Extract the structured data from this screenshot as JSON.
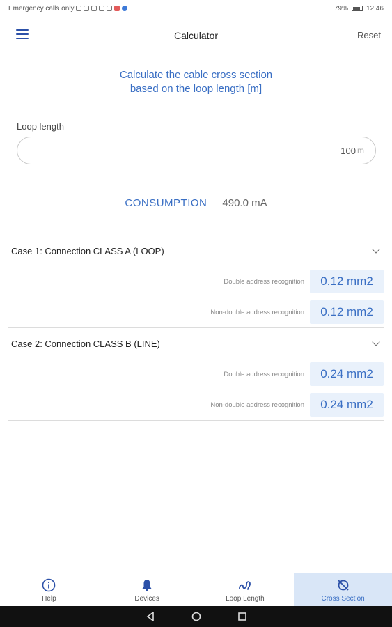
{
  "status_bar": {
    "left_text": "Emergency calls only",
    "battery": "79%",
    "time": "12:46"
  },
  "app_bar": {
    "menu_icon": "hamburger-menu-icon",
    "title": "Calculator",
    "reset_label": "Reset"
  },
  "intro": {
    "line1": "Calculate the cable cross section",
    "line2": "based on the loop length [m]"
  },
  "loop_length": {
    "label": "Loop length",
    "value": "100",
    "unit": "m"
  },
  "consumption": {
    "label": "CONSUMPTION",
    "value": "490.0 mA"
  },
  "cases": [
    {
      "title": "Case 1: Connection CLASS A (LOOP)",
      "rows": [
        {
          "label": "Double address recognition",
          "value": "0.12 mm2"
        },
        {
          "label": "Non-double address recognition",
          "value": "0.12 mm2"
        }
      ]
    },
    {
      "title": "Case 2: Connection CLASS B (LINE)",
      "rows": [
        {
          "label": "Double address recognition",
          "value": "0.24 mm2"
        },
        {
          "label": "Non-double address recognition",
          "value": "0.24 mm2"
        }
      ]
    }
  ],
  "bottom_nav": [
    {
      "label": "Help",
      "icon": "info-icon",
      "active": false
    },
    {
      "label": "Devices",
      "icon": "bell-icon",
      "active": false
    },
    {
      "label": "Loop Length",
      "icon": "loop-icon",
      "active": false
    },
    {
      "label": "Cross Section",
      "icon": "cross-section-icon",
      "active": true
    }
  ],
  "colors": {
    "accent": "#3a6fc4",
    "active_tab_bg": "#d9e6f7",
    "result_bg": "#e9f1fb"
  }
}
